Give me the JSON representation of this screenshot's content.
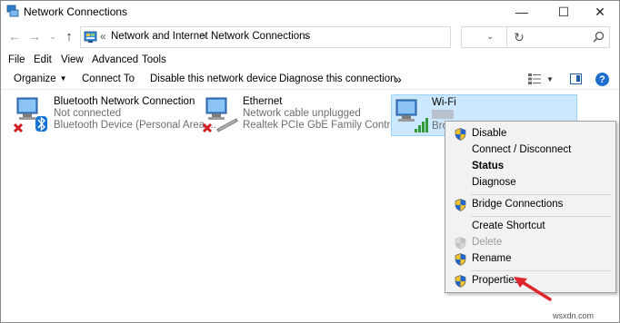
{
  "window": {
    "title": "Network Connections",
    "minimize": "—",
    "maximize": "☐",
    "close": "✕"
  },
  "address": {
    "back": "←",
    "forward": "→",
    "history": "⌄",
    "up": "↑",
    "prefix": "«",
    "crumbs": [
      "Network and Internet",
      "Network Connections"
    ],
    "separator": ">",
    "dropdown": "⌄",
    "refresh": "↻",
    "search_placeholder": ""
  },
  "menu": [
    "File",
    "Edit",
    "View",
    "Advanced",
    "Tools"
  ],
  "commands": {
    "organize": "Organize",
    "organize_arrow": "▼",
    "connect_to": "Connect To",
    "disable": "Disable this network device",
    "diagnose": "Diagnose this connection",
    "more": "»",
    "view_dd": "▼",
    "help": "?"
  },
  "connections": [
    {
      "name": "Bluetooth Network Connection",
      "status": "Not connected",
      "device": "Bluetooth Device (Personal Area ..."
    },
    {
      "name": "Ethernet",
      "status": "Network cable unplugged",
      "device": "Realtek PCIe GbE Family Controller"
    },
    {
      "name": "Wi-Fi",
      "status": "NOK",
      "device": "Bro"
    }
  ],
  "context_menu": {
    "items": [
      {
        "label": "Disable",
        "shield": true,
        "bold": false,
        "disabled": false
      },
      {
        "label": "Connect / Disconnect",
        "shield": false,
        "bold": false,
        "disabled": false
      },
      {
        "label": "Status",
        "shield": false,
        "bold": true,
        "disabled": false
      },
      {
        "label": "Diagnose",
        "shield": false,
        "bold": false,
        "disabled": false
      },
      {
        "label": "Bridge Connections",
        "shield": true,
        "bold": false,
        "disabled": false
      },
      {
        "label": "Create Shortcut",
        "shield": false,
        "bold": false,
        "disabled": false
      },
      {
        "label": "Delete",
        "shield": true,
        "bold": false,
        "disabled": true
      },
      {
        "label": "Rename",
        "shield": true,
        "bold": false,
        "disabled": false
      },
      {
        "label": "Properties",
        "shield": true,
        "bold": false,
        "disabled": false
      }
    ]
  },
  "watermark": "wsxdn.com",
  "colors": {
    "selection_bg": "#cce8ff",
    "selection_border": "#99d1ff",
    "menu_bg": "#f2f2f2",
    "accent_blue": "#1f6fcf",
    "arrow_red": "#e0262d"
  }
}
